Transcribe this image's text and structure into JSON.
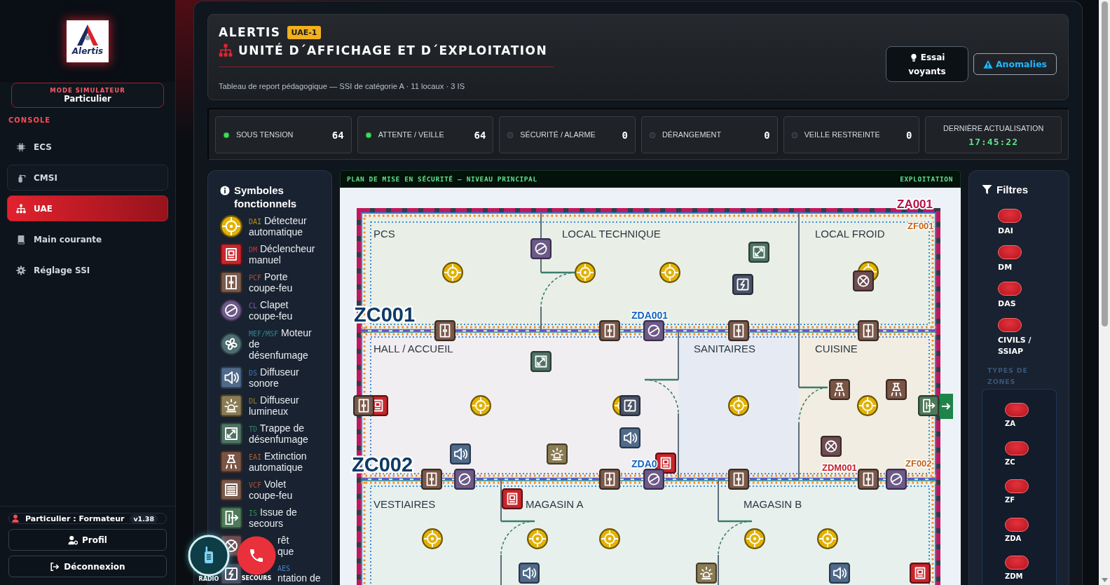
{
  "sidebar": {
    "logo": "Alertis",
    "mode": {
      "label": "MODE SIMULATEUR",
      "value": "Particulier"
    },
    "section": "CONSOLE",
    "items": [
      {
        "label": "ECS",
        "selected": false,
        "focused": false
      },
      {
        "label": "CMSI",
        "selected": false,
        "focused": true
      },
      {
        "label": "UAE",
        "selected": true,
        "focused": false
      },
      {
        "label": "Main courante",
        "selected": false,
        "focused": false
      },
      {
        "label": "Réglage SSI",
        "selected": false,
        "focused": false
      }
    ],
    "user": {
      "label": "Particulier : Formateur",
      "version": "v1.38"
    },
    "buttons": [
      {
        "label": "Profil"
      },
      {
        "label": "Déconnexion"
      }
    ]
  },
  "header": {
    "brand": "ALERTIS",
    "badge": "UAE-1",
    "title": "UNITÉ D´AFFICHAGE ET D´EXPLOITATION",
    "subtitle": "Tableau de report pédagogique — SSI de catégorie A · 11 locaux · 3 IS",
    "buttons": [
      {
        "label": "Essai voyants",
        "kind": "dark"
      },
      {
        "label": "Anomalies",
        "kind": "outline"
      }
    ]
  },
  "indicators": [
    {
      "label": "SOUS TENSION",
      "value": "64",
      "on": true
    },
    {
      "label": "ATTENTE / VEILLE",
      "value": "64",
      "on": true
    },
    {
      "label": "SÉCURITÉ / ALARME",
      "value": "0",
      "on": false
    },
    {
      "label": "DÉRANGEMENT",
      "value": "0",
      "on": false
    },
    {
      "label": "VEILLE RESTREINTE",
      "value": "0",
      "on": false
    }
  ],
  "last_update": {
    "label": "DERNIÈRE ACTUALISATION",
    "value": "17:45:22"
  },
  "legend": {
    "title": "Symboles fonctionnels",
    "items": [
      {
        "code": "DAI",
        "label": "Détecteur automatique",
        "kind": "detector",
        "covered": false
      },
      {
        "code": "DM",
        "label": "Déclencheur manuel",
        "kind": "manual-call",
        "covered": false
      },
      {
        "code": "PCF",
        "label": "Porte coupe-feu",
        "kind": "fire-door",
        "covered": false
      },
      {
        "code": "CL",
        "label": "Clapet coupe-feu",
        "kind": "damper",
        "covered": false
      },
      {
        "code": "MEF/MSF",
        "label": "Moteur de désenfumage",
        "kind": "fan",
        "covered": false
      },
      {
        "code": "DS",
        "label": "Diffuseur sonore",
        "kind": "sounder",
        "covered": false
      },
      {
        "code": "DL",
        "label": "Diffuseur lumineux",
        "kind": "beacon",
        "covered": false
      },
      {
        "code": "TD",
        "label": "Trappe de désenfumage",
        "kind": "hatch",
        "covered": false
      },
      {
        "code": "EAI",
        "label": "Extinction automatique",
        "kind": "sprinkler",
        "covered": false
      },
      {
        "code": "VCF",
        "label": "Volet coupe-feu",
        "kind": "shutter",
        "covered": false
      },
      {
        "code": "IS",
        "label": "Issue de secours",
        "kind": "exit",
        "covered": false
      },
      {
        "label": "rêt que",
        "kind": "stop",
        "covered": true
      },
      {
        "code": "AES",
        "label": "ntation de",
        "kind": "power",
        "covered": true
      }
    ]
  },
  "quick_actions": [
    {
      "label": "RADIO",
      "kind": "radio",
      "active": true
    },
    {
      "label": "SECOURS",
      "kind": "emergency",
      "active": false
    }
  ],
  "plan": {
    "title": "PLAN DE MISE EN SÉCURITÉ — NIVEAU PRINCIPAL",
    "mode": "EXPLOITATION",
    "rooms": [
      {
        "name": "PCS"
      },
      {
        "name": "LOCAL TECHNIQUE"
      },
      {
        "name": "LOCAL FROID"
      },
      {
        "name": "HALL / ACCUEIL"
      },
      {
        "name": "SANITAIRES"
      },
      {
        "name": "CUISINE"
      },
      {
        "name": "VESTIAIRES"
      },
      {
        "name": "MAGASIN A"
      },
      {
        "name": "MAGASIN B"
      }
    ],
    "zone_labels": [
      {
        "text": "ZA001",
        "kind": "za"
      },
      {
        "text": "ZF001",
        "kind": "zf"
      },
      {
        "text": "ZC001",
        "kind": "zc"
      },
      {
        "text": "ZDA001",
        "kind": "zda"
      },
      {
        "text": "ZC002",
        "kind": "zc"
      },
      {
        "text": "ZDA0",
        "kind": "zda"
      },
      {
        "text": "ZDM001",
        "kind": "zdm"
      },
      {
        "text": "ZF002",
        "kind": "zf"
      }
    ]
  },
  "filters": {
    "title": "Filtres",
    "items": [
      {
        "label": "DAI",
        "on": true
      },
      {
        "label": "DM",
        "on": true
      },
      {
        "label": "DAS",
        "on": true
      },
      {
        "label": "CIVILS / SSIAP",
        "on": true
      }
    ],
    "zone_types": {
      "title": "TYPES DE ZONES",
      "items": [
        {
          "label": "ZA",
          "on": true
        },
        {
          "label": "ZC",
          "on": true
        },
        {
          "label": "ZF",
          "on": true
        },
        {
          "label": "ZDA",
          "on": true
        },
        {
          "label": "ZDM",
          "on": true
        }
      ]
    }
  }
}
